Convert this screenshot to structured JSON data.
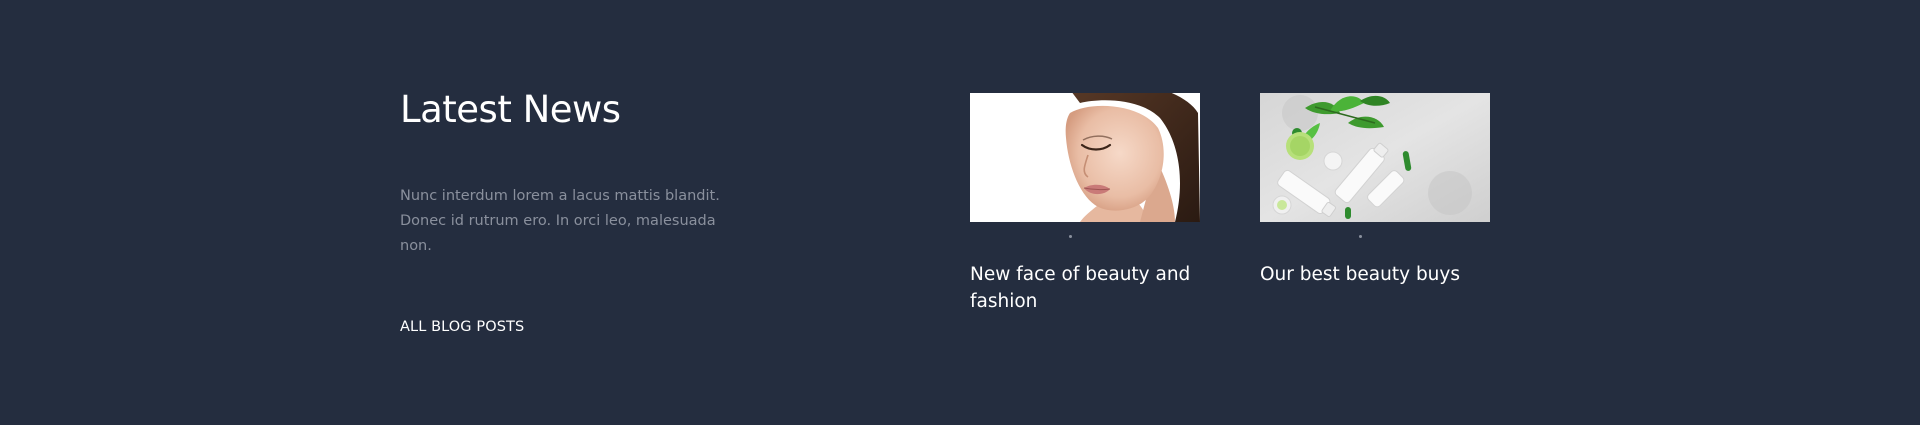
{
  "latest_news": {
    "title": "Latest News",
    "description": "Nunc interdum lorem a lacus mattis blandit. Donec id rutrum ero. In orci leo, malesuada non.",
    "all_posts_label": "ALL BLOG POSTS"
  },
  "posts": [
    {
      "title": "New face of beauty and fashion",
      "image": "woman-face-photo"
    },
    {
      "title": "Our best beauty buys",
      "image": "cosmetics-products-photo"
    }
  ],
  "colors": {
    "background": "#242d3f",
    "text": "#ffffff",
    "muted_text": "#8a909d"
  }
}
